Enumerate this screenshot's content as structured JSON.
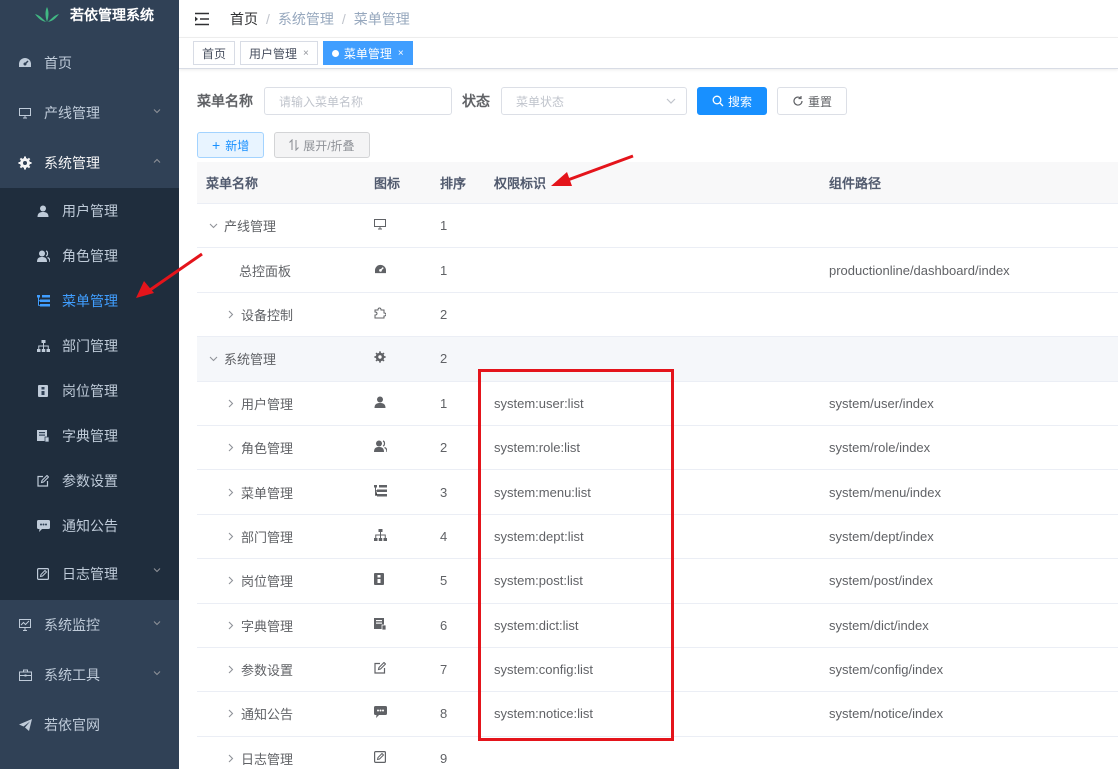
{
  "app": {
    "title": "若依管理系统"
  },
  "sidebar": {
    "items": [
      {
        "label": "首页",
        "icon": "dashboard-icon"
      },
      {
        "label": "产线管理",
        "icon": "monitor-icon"
      },
      {
        "label": "系统管理",
        "icon": "gear-icon"
      },
      {
        "label": "系统监控",
        "icon": "monitor-chart-icon"
      },
      {
        "label": "系统工具",
        "icon": "toolbox-icon"
      },
      {
        "label": "若依官网",
        "icon": "send-icon"
      }
    ],
    "sub_items": [
      {
        "label": "用户管理",
        "icon": "user-icon"
      },
      {
        "label": "角色管理",
        "icon": "users-icon"
      },
      {
        "label": "菜单管理",
        "icon": "tree-table-icon"
      },
      {
        "label": "部门管理",
        "icon": "org-tree-icon"
      },
      {
        "label": "岗位管理",
        "icon": "post-icon"
      },
      {
        "label": "字典管理",
        "icon": "dict-icon"
      },
      {
        "label": "参数设置",
        "icon": "edit-icon"
      },
      {
        "label": "通知公告",
        "icon": "message-icon"
      },
      {
        "label": "日志管理",
        "icon": "log-icon"
      }
    ]
  },
  "breadcrumb": [
    "首页",
    "系统管理",
    "菜单管理"
  ],
  "tags": [
    {
      "label": "首页"
    },
    {
      "label": "用户管理"
    },
    {
      "label": "菜单管理",
      "active": true
    }
  ],
  "search": {
    "menu_name_label": "菜单名称",
    "menu_name_placeholder": "请输入菜单名称",
    "status_label": "状态",
    "status_placeholder": "菜单状态",
    "search_button": "搜索",
    "reset_button": "重置"
  },
  "toolbar": {
    "add_button": "新增",
    "expand_button": "展开/折叠"
  },
  "table": {
    "columns": [
      "菜单名称",
      "图标",
      "排序",
      "权限标识",
      "组件路径"
    ],
    "rows": [
      {
        "name": "产线管理",
        "expander": "down",
        "level": 1,
        "icon": "monitor-icon",
        "order": "1",
        "perm": "",
        "path": ""
      },
      {
        "name": "总控面板",
        "expander": "none",
        "level": 2,
        "icon": "dashboard-icon",
        "order": "1",
        "perm": "",
        "path": "productionline/dashboard/index"
      },
      {
        "name": "设备控制",
        "expander": "right",
        "level": 2,
        "icon": "puzzle-icon",
        "order": "2",
        "perm": "",
        "path": ""
      },
      {
        "name": "系统管理",
        "expander": "down",
        "level": 1,
        "icon": "gear-icon",
        "order": "2",
        "perm": "",
        "path": "",
        "highlight": true
      },
      {
        "name": "用户管理",
        "expander": "right",
        "level": 2,
        "icon": "user-icon",
        "order": "1",
        "perm": "system:user:list",
        "path": "system/user/index"
      },
      {
        "name": "角色管理",
        "expander": "right",
        "level": 2,
        "icon": "users-icon",
        "order": "2",
        "perm": "system:role:list",
        "path": "system/role/index"
      },
      {
        "name": "菜单管理",
        "expander": "right",
        "level": 2,
        "icon": "tree-table-icon",
        "order": "3",
        "perm": "system:menu:list",
        "path": "system/menu/index"
      },
      {
        "name": "部门管理",
        "expander": "right",
        "level": 2,
        "icon": "org-tree-icon",
        "order": "4",
        "perm": "system:dept:list",
        "path": "system/dept/index"
      },
      {
        "name": "岗位管理",
        "expander": "right",
        "level": 2,
        "icon": "post-icon",
        "order": "5",
        "perm": "system:post:list",
        "path": "system/post/index"
      },
      {
        "name": "字典管理",
        "expander": "right",
        "level": 2,
        "icon": "dict-icon",
        "order": "6",
        "perm": "system:dict:list",
        "path": "system/dict/index"
      },
      {
        "name": "参数设置",
        "expander": "right",
        "level": 2,
        "icon": "edit-icon",
        "order": "7",
        "perm": "system:config:list",
        "path": "system/config/index"
      },
      {
        "name": "通知公告",
        "expander": "right",
        "level": 2,
        "icon": "message-icon",
        "order": "8",
        "perm": "system:notice:list",
        "path": "system/notice/index"
      },
      {
        "name": "日志管理",
        "expander": "right",
        "level": 2,
        "icon": "log-icon",
        "order": "9",
        "perm": "",
        "path": ""
      }
    ]
  },
  "colors": {
    "sidebar_bg": "#304156",
    "submenu_bg": "#1f2d3d",
    "accent": "#409eff",
    "annotation_red": "#e4141b"
  }
}
